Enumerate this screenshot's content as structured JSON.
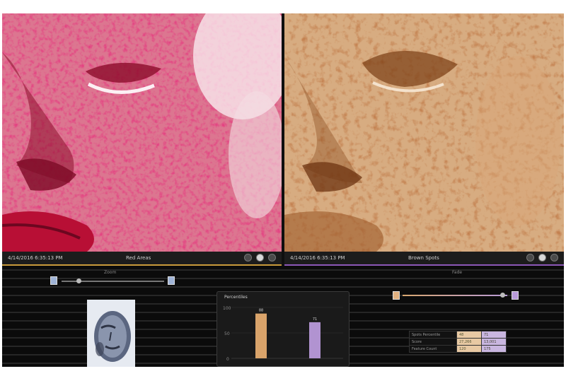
{
  "left_panel": {
    "date": "4/14/2016 6:35:13 PM",
    "mode": "Red Areas",
    "accent": "#c99a3b"
  },
  "right_panel": {
    "date": "4/14/2016 6:35:13 PM",
    "mode": "Brown Spots",
    "accent": "#8c58b8"
  },
  "bottom": {
    "left_slider_label": "Zoom",
    "right_slider_label": "Fade",
    "chart": {
      "title": "Percentiles",
      "y_ticks": [
        "100",
        "50",
        "0"
      ]
    },
    "table": {
      "rows": [
        {
          "label": "Spots Percentile",
          "v1": "48",
          "v2": "71"
        },
        {
          "label": "Score",
          "v1": "27,266",
          "v2": "13,001"
        },
        {
          "label": "Feature Count",
          "v1": "120",
          "v2": "175"
        }
      ]
    }
  },
  "chart_data": {
    "type": "bar",
    "title": "Percentiles",
    "categories": [
      "Red Areas",
      "Brown Spots"
    ],
    "values": [
      88,
      71
    ],
    "ylim": [
      0,
      100
    ],
    "colors": [
      "#d9a36a",
      "#b193d1"
    ]
  }
}
